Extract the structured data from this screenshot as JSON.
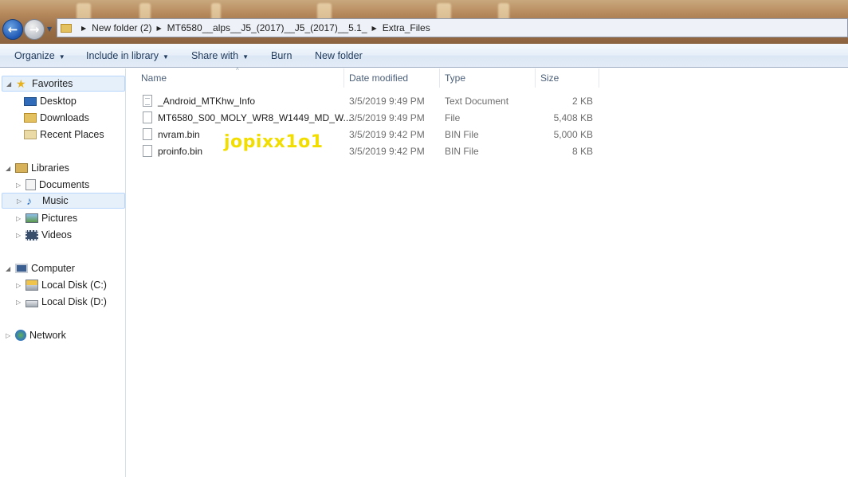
{
  "address": {
    "crumbs": [
      "New folder (2)",
      "MT6580__alps__J5_(2017)__J5_(2017)__5.1_",
      "Extra_Files"
    ]
  },
  "commands": {
    "organize": "Organize",
    "include_in_library": "Include in library",
    "share_with": "Share with",
    "burn": "Burn",
    "new_folder": "New folder"
  },
  "navigation": {
    "favorites": "Favorites",
    "desktop": "Desktop",
    "downloads": "Downloads",
    "recent_places": "Recent Places",
    "libraries": "Libraries",
    "documents": "Documents",
    "music": "Music",
    "pictures": "Pictures",
    "videos": "Videos",
    "computer": "Computer",
    "local_disk_c": "Local Disk (C:)",
    "local_disk_d": "Local Disk (D:)",
    "network": "Network"
  },
  "columns": {
    "name": "Name",
    "date_modified": "Date modified",
    "type": "Type",
    "size": "Size"
  },
  "files": [
    {
      "name": "_Android_MTKhw_Info",
      "date": "3/5/2019 9:49 PM",
      "type": "Text Document",
      "size": "2 KB"
    },
    {
      "name": "MT6580_S00_MOLY_WR8_W1449_MD_W...",
      "date": "3/5/2019 9:49 PM",
      "type": "File",
      "size": "5,408 KB"
    },
    {
      "name": "nvram.bin",
      "date": "3/5/2019 9:42 PM",
      "type": "BIN File",
      "size": "5,000 KB"
    },
    {
      "name": "proinfo.bin",
      "date": "3/5/2019 9:42 PM",
      "type": "BIN File",
      "size": "8 KB"
    }
  ],
  "watermark": "jopixx1o1",
  "colors": {
    "accent": "#1f58b3",
    "watermark": "#f2dd00",
    "selection": "#e5f0fb"
  }
}
